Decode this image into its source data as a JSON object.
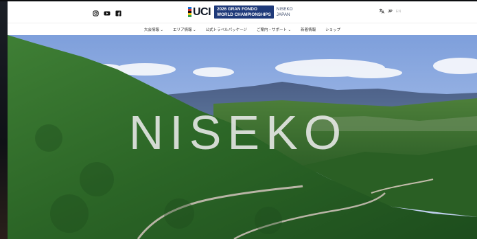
{
  "header": {
    "social": [
      "instagram-icon",
      "youtube-icon",
      "facebook-icon"
    ],
    "logo": {
      "brand": "UCI",
      "event_line1": "2026 GRAN FONDO",
      "event_line2": "WORLD CHAMPIONSHIPS",
      "location_line1": "NISEKO",
      "location_line2": "JAPAN"
    },
    "lang": {
      "icon": "translate-icon",
      "active": "JP",
      "other": "EN"
    }
  },
  "nav": {
    "items": [
      "大会情報 ⌄",
      "エリア情報 ⌄",
      "公式トラベルパッケージ",
      "ご案内・サポート ⌄",
      "新着情報",
      "ショップ"
    ]
  },
  "hero": {
    "title": "NISEKO"
  },
  "colors": {
    "brand_blue": "#1f3a7a",
    "forest": "#2e6a2a",
    "sky": "#9bb6e6"
  }
}
